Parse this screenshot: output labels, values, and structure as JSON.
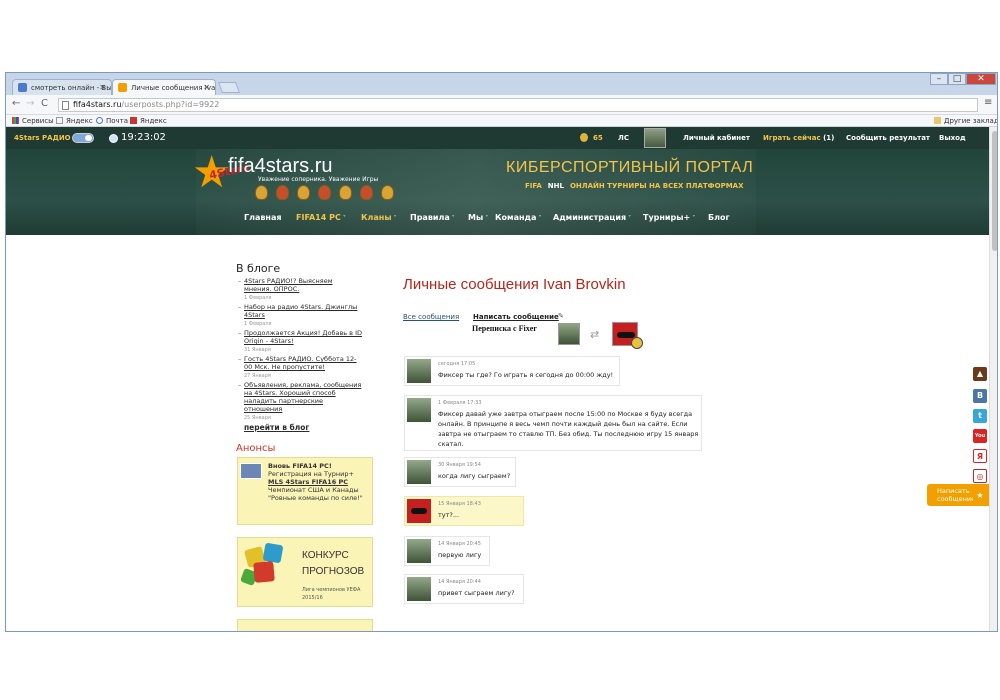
{
  "browser": {
    "tabs": [
      {
        "label": "смотреть онлайн - Вы…"
      },
      {
        "label": "Личные сообщения Ivan"
      }
    ],
    "url_host": "fifa4stars.ru",
    "url_path": "/userposts.php?id=9922",
    "bookmarks": [
      "Сервисы",
      "Яндекс",
      "Почта",
      "Яндекс"
    ],
    "other_bookmarks": "Другие закладки",
    "window_buttons": {
      "min": "–",
      "max": "□",
      "close": "✕"
    }
  },
  "topbar": {
    "radio": "4Stars РАДИО",
    "time": "19:23:02",
    "coins": "65",
    "ls": "ЛС",
    "cabinet": "Личный кабинет",
    "play_now": "Играть сейчас",
    "play_count": "(1)",
    "report": "Сообщить результат",
    "logout": "Выход"
  },
  "header": {
    "logo_text": "fifa4stars.ru",
    "logo_badge": "4Stars",
    "tagline": "Уважение соперника. Уважение Игры",
    "portal_title": "КИБЕРСПОРТИВНЫЙ ПОРТАЛ",
    "portal_fifa": "FIFA",
    "portal_nhl": "NHL",
    "portal_rest": "ОНЛАЙН ТУРНИРЫ НА ВСЕХ ПЛАТФОРМАХ"
  },
  "nav": [
    "Главная",
    "FIFA14 PC",
    "Кланы",
    "Правила",
    "Мы",
    "Команда",
    "Администрация",
    "Турниры+",
    "Блог"
  ],
  "blog": {
    "title": "В блоге",
    "posts": [
      {
        "title": "4Stars РАДИО!? Выясняем мнения. ОПРОС.",
        "date": "1 Февраля"
      },
      {
        "title": "Набор на радио 4Stars. Джинглы 4Stars",
        "date": "1 Февраля"
      },
      {
        "title": "Продолжается Акция! Добавь в ID Origin - 4Stars!",
        "date": "31 Января"
      },
      {
        "title": "Гость 4Stars РАДИО. Суббота 12-00 Мск. Не пропустите!",
        "date": "27 Января"
      },
      {
        "title": "Объявления, реклама, сообщения на 4Stars. Хороший способ наладить партнерские отношения",
        "date": "25 Января"
      }
    ],
    "more": "перейти в блог"
  },
  "announcements": {
    "title": "Анонсы",
    "box1": {
      "headline": "Вновь FIFA14 PC!",
      "line1": "Регистрация на Турнир+",
      "line2": "MLS 4Stars FIFA16 PC",
      "line3": "Чемпионат США и Канады",
      "line4": "\"Ровные команды по силе!\""
    },
    "box2": {
      "title1": "КОНКУРС",
      "title2": "ПРОГНОЗОВ",
      "sub1": "Лига чемпионов УЕФА",
      "sub2": "2015/16"
    }
  },
  "pm": {
    "title": "Личные сообщения Ivan Brovkin",
    "all": "Все сообщения",
    "write": "Написать сообщение",
    "with": "Переписка с Fixer",
    "messages": [
      {
        "date": "сегодня 17:05",
        "text": "Фиксер ты где? Го играть я сегодня до 00:00 жду!",
        "mine": false
      },
      {
        "date": "1 Февраля 17:33",
        "text": "Фиксер давай уже завтра отыграем после 15:00 по Москве я буду всегда онлайн. В принципе я весь чемп почти каждый день был на сайте. Если завтра не отыграем то ставлю ТП. Без обид. Ты последнюю игру 15 января скатал.",
        "mine": false
      },
      {
        "date": "30 Января 19:54",
        "text": "когда лигу сыграем?",
        "mine": false
      },
      {
        "date": "15 Января 18:43",
        "text": "тут?...",
        "mine": true
      },
      {
        "date": "14 Января 20:45",
        "text": "первую лигу",
        "mine": false
      },
      {
        "date": "14 Января 20:44",
        "text": "привет сыграем лигу?",
        "mine": false
      }
    ]
  },
  "social": {
    "write": "Написать сообщение",
    "vk": "В",
    "tw": "t",
    "yt": "You",
    "ya": "Я",
    "star": "★"
  }
}
